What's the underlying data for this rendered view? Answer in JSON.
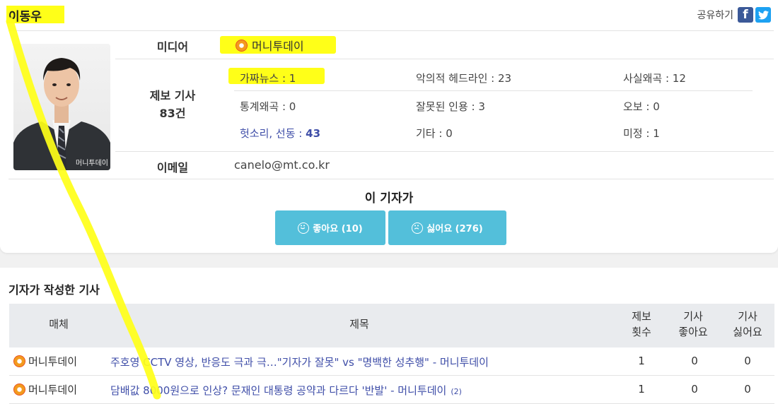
{
  "reporter": {
    "name": "이동우"
  },
  "share": {
    "label": "공유하기",
    "facebook_icon": "facebook-icon",
    "twitter_icon": "twitter-icon"
  },
  "photo": {
    "watermark": "머니투데이"
  },
  "profile": {
    "media_label": "미디어",
    "media_name": "머니투데이",
    "reports_label_line1": "제보 기사",
    "reports_label_line2": "83건",
    "email_label": "이메일",
    "email": "canelo@mt.co.kr"
  },
  "stats": [
    {
      "label": "가짜뉴스 : 1"
    },
    {
      "label": "악의적 헤드라인 : 23"
    },
    {
      "label": "사실왜곡 : 12"
    },
    {
      "label": "통계왜곡 : 0"
    },
    {
      "label": "잘못된 인용 : 3"
    },
    {
      "label": "오보 : 0"
    },
    {
      "label": "헛소리, 선동 : ",
      "value": "43"
    },
    {
      "label": "기타 : 0"
    },
    {
      "label": "미정 : 1"
    }
  ],
  "vote": {
    "title": "이 기자가",
    "like_label": "좋아요 (10)",
    "dislike_label": "싫어요 (276)"
  },
  "articles": {
    "section_title": "기자가 작성한 기사",
    "headers": {
      "media": "매체",
      "title": "제목",
      "reports_line1": "제보",
      "reports_line2": "횟수",
      "likes_line1": "기사",
      "likes_line2": "좋아요",
      "dislikes_line1": "기사",
      "dislikes_line2": "싫어요"
    },
    "rows": [
      {
        "media": "머니투데이",
        "title": "주호영 CCTV 영상, 반응도 극과 극…\"기자가 잘못\" vs \"명백한 성추행\" - 머니투데이",
        "comments": "",
        "reports": "1",
        "likes": "0",
        "dislikes": "0"
      },
      {
        "media": "머니투데이",
        "title": "담배값 8000원으로 인상? 문재인 대통령 공약과 다르다 '반발' - 머니투데이",
        "comments": "(2)",
        "reports": "1",
        "likes": "0",
        "dislikes": "0"
      }
    ]
  },
  "colors": {
    "link": "#3f4ea8",
    "button": "#53bfda",
    "highlight": "#ffff18"
  }
}
